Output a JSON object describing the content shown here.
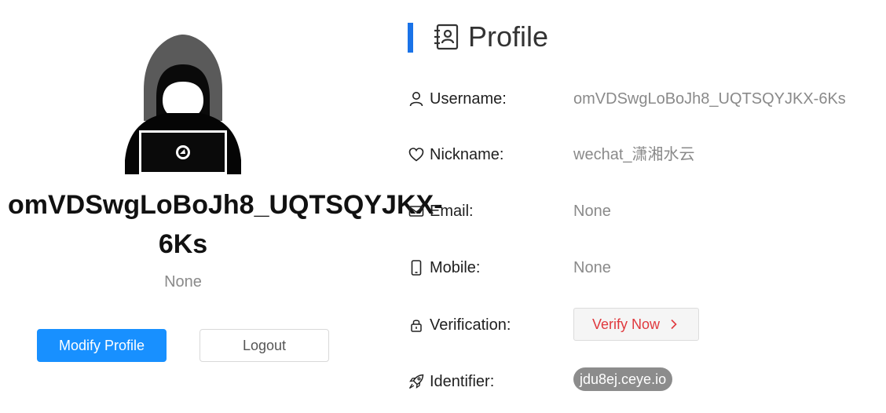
{
  "profile_card": {
    "display_name_line1": "omVDSwgLoBoJh8_UQTSQYJKX-",
    "display_name_line2": "6Ks",
    "subtitle": "None",
    "modify_button": "Modify Profile",
    "logout_button": "Logout"
  },
  "panel": {
    "title": "Profile",
    "accent_color": "#1a73e8",
    "fields": [
      {
        "icon": "user-icon",
        "label": "Username:",
        "value": "omVDSwgLoBoJh8_UQTSQYJKX-6Ks"
      },
      {
        "icon": "heart-icon",
        "label": "Nickname:",
        "value": "wechat_潇湘水云"
      },
      {
        "icon": "mail-icon",
        "label": "Email:",
        "value": "None"
      },
      {
        "icon": "mobile-icon",
        "label": "Mobile:",
        "value": "None"
      },
      {
        "icon": "lock-icon",
        "label": "Verification:",
        "action": "Verify Now"
      },
      {
        "icon": "rocket-icon",
        "label": "Identifier:",
        "value": "jdu8ej.ceye.io"
      }
    ]
  },
  "colors": {
    "primary_button": "#1890ff",
    "verify_text": "#e0393e",
    "identifier_pill": "#8c8c8c"
  }
}
